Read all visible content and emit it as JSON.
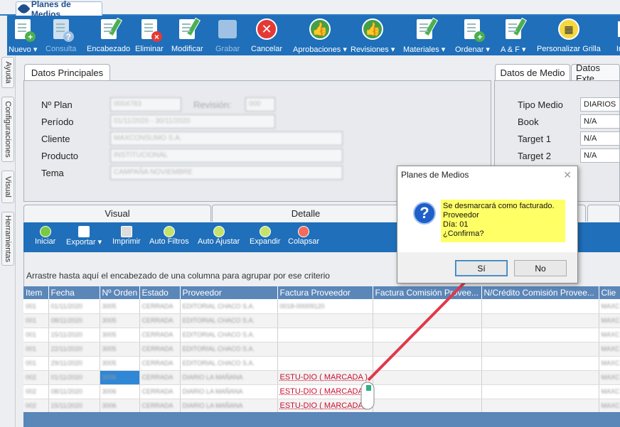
{
  "doc_tab": {
    "title": "Planes de Medios"
  },
  "ribbon": [
    {
      "label": "Nuevo ▾",
      "icon": "new-document-icon",
      "disabled": false
    },
    {
      "label": "Consulta",
      "icon": "query-document-icon",
      "disabled": true
    },
    {
      "label": "Encabezado",
      "icon": "edit-header-icon",
      "disabled": false
    },
    {
      "label": "Eliminar",
      "icon": "delete-document-icon",
      "disabled": false
    },
    {
      "label": "Modificar",
      "icon": "modify-icon",
      "disabled": false
    },
    {
      "label": "Grabar",
      "icon": "save-icon",
      "disabled": true
    },
    {
      "label": "Cancelar",
      "icon": "cancel-icon",
      "disabled": false
    },
    {
      "label": "Aprobaciones ▾",
      "icon": "thumbs-up-icon",
      "disabled": false
    },
    {
      "label": "Revisiones ▾",
      "icon": "thumbs-up-icon",
      "disabled": false
    },
    {
      "label": "Materiales ▾",
      "icon": "materials-icon",
      "disabled": false
    },
    {
      "label": "Ordenar ▾",
      "icon": "order-icon",
      "disabled": false
    },
    {
      "label": "A & F ▾",
      "icon": "af-icon",
      "disabled": false
    },
    {
      "label": "Personalizar Grilla",
      "icon": "grid-customize-icon",
      "disabled": false
    },
    {
      "label": "Im",
      "icon": "print-icon",
      "disabled": false
    }
  ],
  "side_tabs": [
    "Ayuda",
    "Configuraciones",
    "Visual",
    "Herramientas"
  ],
  "principal": {
    "tab": "Datos Principales",
    "labels": {
      "plan": "Nº Plan",
      "revision": "Revisión:",
      "periodo": "Período",
      "cliente": "Cliente",
      "producto": "Producto",
      "tema": "Tema"
    },
    "values": {
      "plan": "0004783",
      "revision": "000",
      "periodo": "01/11/2020 - 30/11/2020",
      "cliente": "MAXCONSUMO S.A.",
      "producto": "INSTITUCIONAL",
      "tema": "CAMPAÑA NOVIEMBRE"
    }
  },
  "medio": {
    "tabs": [
      "Datos de Medio",
      "Datos Exte"
    ],
    "labels": {
      "tipo": "Tipo Medio",
      "book": "Book",
      "target1": "Target 1",
      "target2": "Target 2"
    },
    "values": {
      "tipo": "DIARIOS",
      "book": "N/A",
      "target1": "N/A",
      "target2": "N/A"
    }
  },
  "lower_tabs": [
    "Visual",
    "Detalle"
  ],
  "grid_toolbar": [
    "Iniciar",
    "Exportar ▾",
    "Imprimir",
    "Auto Filtros",
    "Auto Ajustar",
    "Expandir",
    "Colapsar"
  ],
  "group_hint": "Arrastre hasta aquí el encabezado de una columna para agrupar por ese criterio",
  "grid": {
    "columns": [
      "Item",
      "Fecha",
      "Nº Orden",
      "Estado",
      "Proveedor",
      "Factura Proveedor",
      "Factura Comisión Provee...",
      "N/Crédito Comisión Provee...",
      "Clie"
    ],
    "rows": [
      [
        "001",
        "01/11/2020",
        "3005",
        "CERRADA",
        "EDITORIAL CHACO S.A.",
        "0018-00009120",
        "",
        "",
        "MAXC"
      ],
      [
        "001",
        "08/11/2020",
        "3005",
        "CERRADA",
        "EDITORIAL CHACO S.A.",
        "",
        "",
        "",
        "MAXC"
      ],
      [
        "001",
        "15/11/2020",
        "3005",
        "CERRADA",
        "EDITORIAL CHACO S.A.",
        "",
        "",
        "",
        "MAXC"
      ],
      [
        "001",
        "22/11/2020",
        "3005",
        "CERRADA",
        "EDITORIAL CHACO S.A.",
        "",
        "",
        "",
        "MAXC"
      ],
      [
        "001",
        "29/11/2020",
        "3005",
        "CERRADA",
        "EDITORIAL CHACO S.A.",
        "",
        "",
        "",
        "MAXC"
      ],
      [
        "002",
        "01/11/2020",
        "3006",
        "CERRADA",
        "DIARIO LA MAÑANA",
        "ESTU-DIO    ( MARCADA )",
        "",
        "",
        "MAXC"
      ],
      [
        "002",
        "08/11/2020",
        "3006",
        "CERRADA",
        "DIARIO LA MAÑANA",
        "ESTU-DIO    ( MARCADA )",
        "",
        "",
        "MAXC"
      ],
      [
        "002",
        "15/11/2020",
        "3006",
        "CERRADA",
        "DIARIO LA MAÑANA",
        "ESTU-DIO    ( MARCADA )",
        "",
        "",
        "MAXC"
      ]
    ]
  },
  "dialog": {
    "title": "Planes de Medios",
    "message": [
      "Se desmarcará como facturado.",
      "Proveedor",
      "Día: 01",
      "¿Confirma?"
    ],
    "yes": "Sí",
    "no": "No"
  },
  "colors": {
    "ribbon": "#1f6fba",
    "grid_header": "#5b86b8",
    "highlight": "#ffff66",
    "arrow": "#e0384a"
  }
}
